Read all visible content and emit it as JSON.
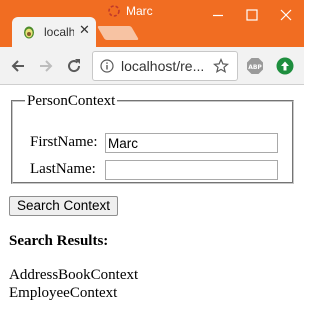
{
  "browser": {
    "tab": {
      "title": "localhost/re...",
      "favicon": "avocado-icon",
      "close_glyph": "✕"
    },
    "profile": {
      "name": "Marc",
      "icon": "profile-icon"
    },
    "window_controls": [
      "minimize-icon",
      "maximize-icon",
      "close-icon"
    ],
    "toolbar": {
      "url": "localhost/re...",
      "icons": [
        "back-arrow-icon",
        "forward-arrow-icon",
        "reload-icon",
        "info-icon",
        "star-icon",
        "adblock-plus-icon",
        "extension-icon"
      ]
    },
    "colors": {
      "titlebar": "#f16d22",
      "toolbar": "#f2f2f2"
    }
  },
  "page": {
    "fieldset_legend": "PersonContext",
    "first_name": {
      "label": "FirstName:",
      "value": "Marc"
    },
    "last_name": {
      "label": "LastName:",
      "value": ""
    },
    "search_button": "Search Context",
    "results_heading": "Search Results:",
    "results": [
      "AddressBookContext",
      "EmployeeContext"
    ]
  }
}
